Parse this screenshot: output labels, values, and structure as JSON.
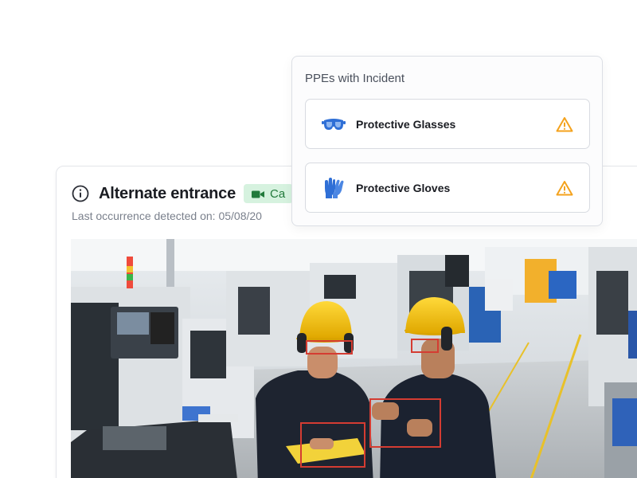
{
  "incident": {
    "title": "Alternate entrance",
    "camera_badge": "Ca",
    "last_occurrence": "Last occurrence detected on: 05/08/20",
    "info_icon": "info-icon",
    "camera_icon": "camera-icon"
  },
  "ppe_panel": {
    "title": "PPEs with Incident",
    "items": [
      {
        "label": "Protective Glasses",
        "icon": "glasses-icon",
        "status_icon": "warning-icon"
      },
      {
        "label": "Protective Gloves",
        "icon": "gloves-icon",
        "status_icon": "warning-icon"
      }
    ]
  },
  "colors": {
    "ppe_icon": "#2f6fd6",
    "warning": "#f4a21c",
    "detection_box": "#d43c32",
    "badge_bg": "#d6f2df",
    "badge_text": "#227a3c"
  }
}
